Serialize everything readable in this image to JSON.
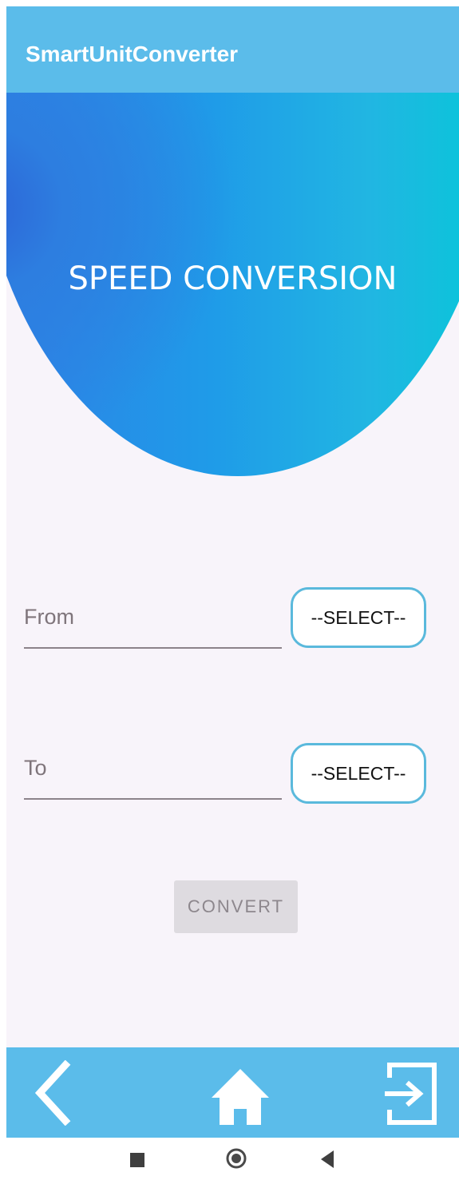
{
  "app_bar": {
    "title": "SmartUnitConverter",
    "color": "#5bbcea"
  },
  "hero": {
    "title": "SPEED CONVERSION"
  },
  "form": {
    "from_placeholder": "From",
    "from_select_label": "--SELECT--",
    "to_placeholder": "To",
    "to_select_label": "--SELECT--",
    "convert_label": "CONVERT"
  },
  "bottom_bar": {
    "icons": [
      "back-chevron-icon",
      "home-icon",
      "exit-icon"
    ]
  },
  "system_nav": {
    "icons": [
      "recents-square-icon",
      "home-circle-icon",
      "back-triangle-icon"
    ]
  },
  "colors": {
    "accent": "#5bbcea",
    "select_border": "#5ab9dc",
    "background": "#f8f4fa"
  }
}
